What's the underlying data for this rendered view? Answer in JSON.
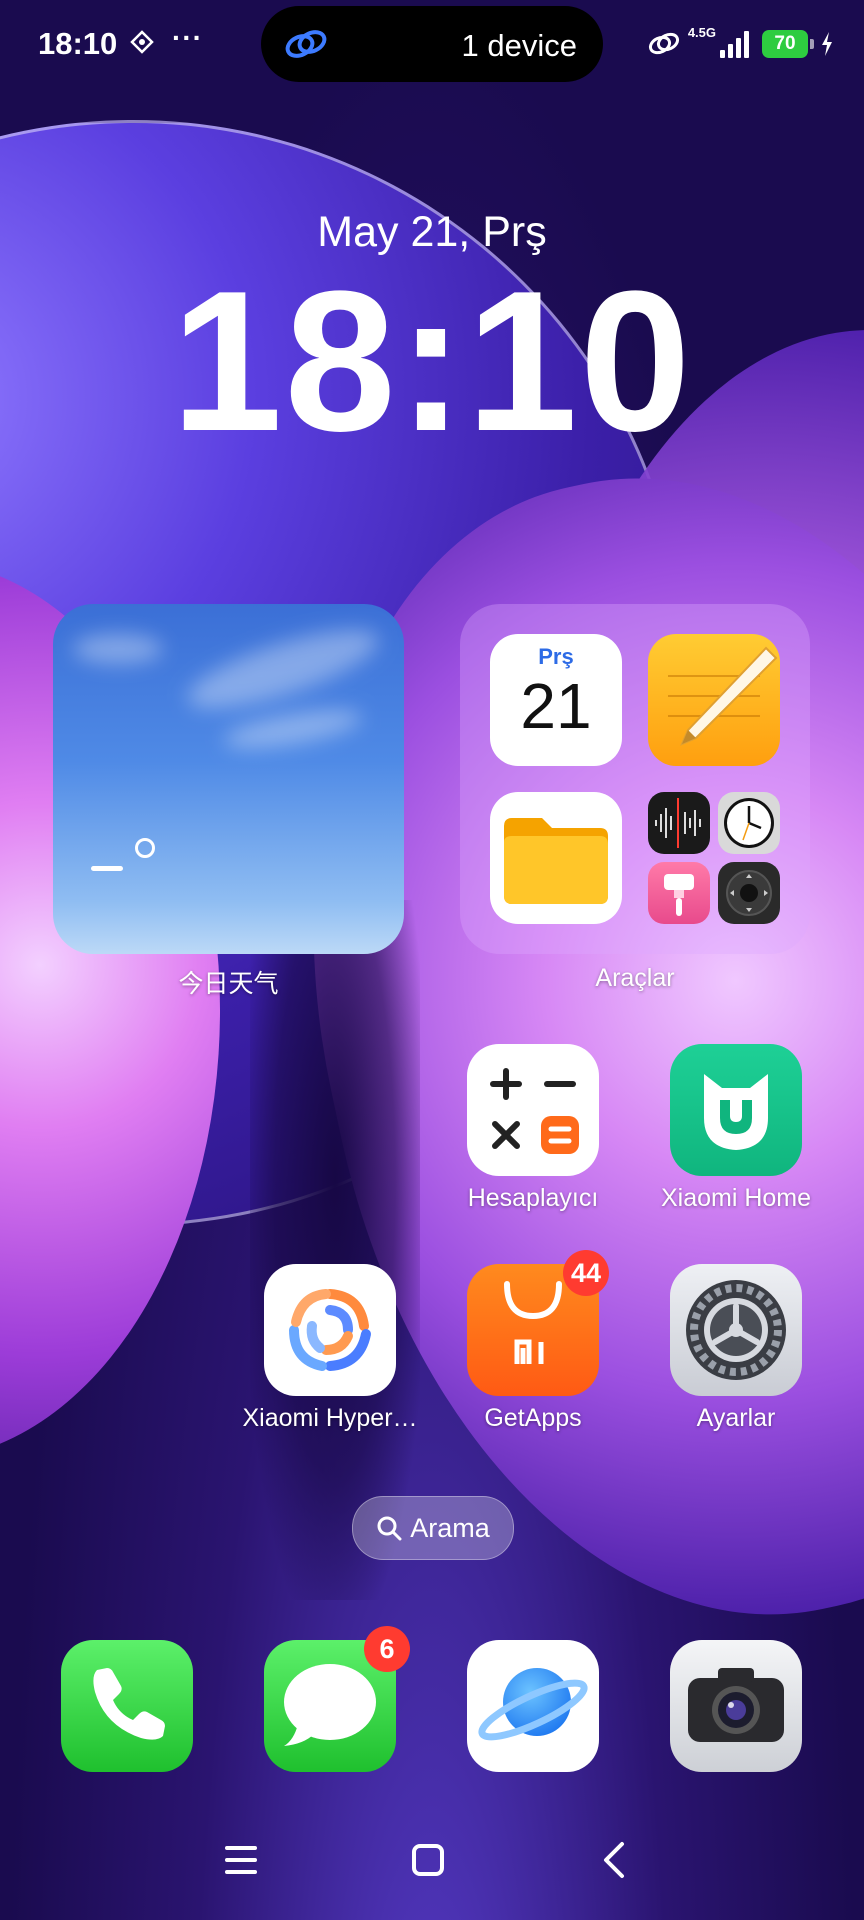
{
  "status_bar": {
    "time": "18:10",
    "more": "···",
    "island_text": "1 device",
    "network": "4.5G",
    "battery": "70"
  },
  "lockclock": {
    "date": "May 21, Prş",
    "time": "18:10"
  },
  "widgets": {
    "weather_label": "今日天气",
    "folder_label": "Araçlar",
    "calendar_day": "Prş",
    "calendar_date": "21"
  },
  "apps": {
    "calculator": "Hesaplayıcı",
    "xiaomi_home": "Xiaomi Home",
    "hyper": "Xiaomi Hyper…",
    "getapps": "GetApps",
    "getapps_badge": "44",
    "settings": "Ayarlar",
    "messages_badge": "6"
  },
  "search": {
    "label": "Arama"
  },
  "colors": {
    "battery": "#2ecc40",
    "badge": "#ff3b30",
    "phone_green": "#34c759"
  }
}
